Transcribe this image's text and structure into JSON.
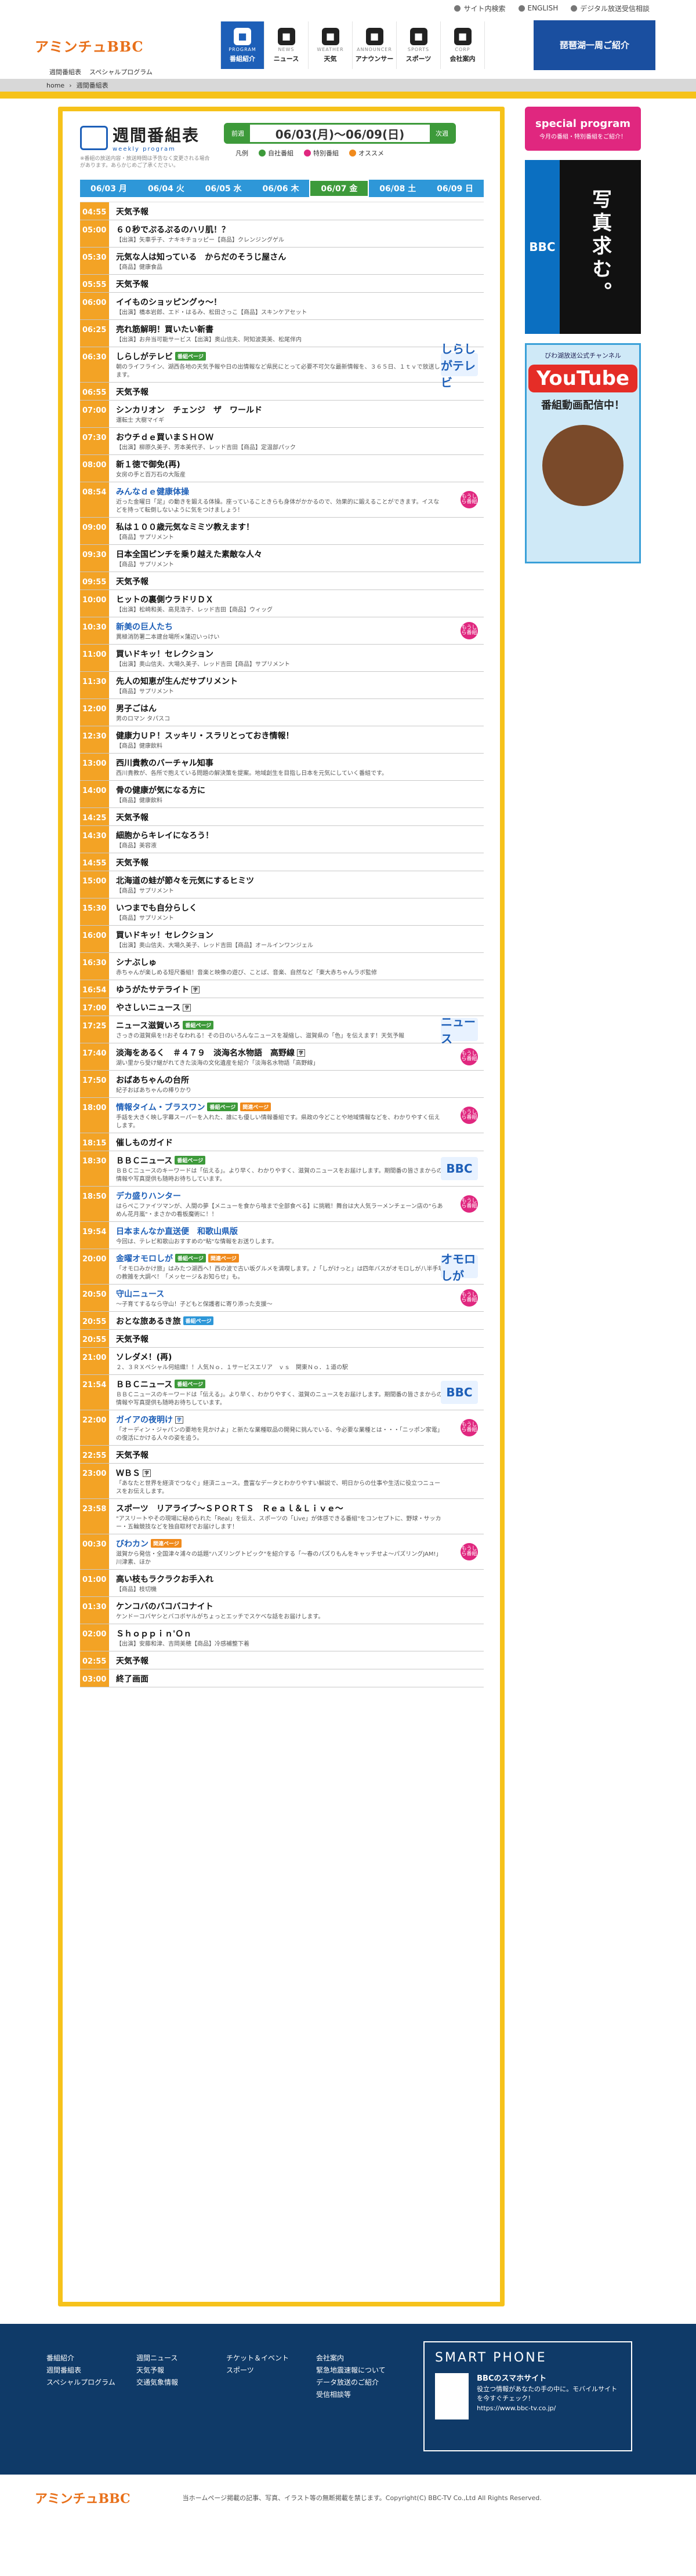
{
  "topbar": {
    "sitemap": "サイト内検索",
    "english": "ENGLISH",
    "digital": "デジタル放送受信相談"
  },
  "logo": {
    "text": "アミンチュBBC"
  },
  "sublinks": [
    "週間番組表",
    "スペシャルプログラム"
  ],
  "gnav": [
    {
      "en": "PROGRAM",
      "ja": "番組紹介",
      "icon": "tv-icon"
    },
    {
      "en": "NEWS",
      "ja": "ニュース",
      "icon": "news-icon"
    },
    {
      "en": "WEATHER",
      "ja": "天気",
      "icon": "weather-icon"
    },
    {
      "en": "ANNOUNCER",
      "ja": "アナウンサー",
      "icon": "mic-icon"
    },
    {
      "en": "SPORTS",
      "ja": "スポーツ",
      "icon": "sports-icon"
    },
    {
      "en": "CORP",
      "ja": "会社案内",
      "icon": "corp-icon"
    }
  ],
  "banner_top": "琵琶湖一周ご紹介",
  "breadcrumb": {
    "home": "home",
    "current": "週間番組表"
  },
  "weekly": {
    "title": "週間番組表",
    "title_en": "weekly program",
    "note": "※番組の放送内容・放送時間は予告なく変更される場合があります。あらかじめご了承ください。",
    "prev": "前週",
    "next": "次週",
    "range": "06/03(月)〜06/09(日)"
  },
  "legend": [
    {
      "label": "凡例"
    },
    {
      "label": "自社番組",
      "color": "#3d9a3a"
    },
    {
      "label": "特別番組",
      "color": "#e0277f"
    },
    {
      "label": "オススメ",
      "color": "#f08a1c"
    }
  ],
  "days": [
    "06/03 月",
    "06/04 火",
    "06/05 水",
    "06/06 木",
    "06/07 金",
    "06/08 土",
    "06/09 日"
  ],
  "programs": [
    {
      "time": "04:55",
      "title": "天気予報",
      "desc": ""
    },
    {
      "time": "05:00",
      "title": "６０秒でぷるぷるのハリ肌！？",
      "desc": "【出演】矢車乎子、ナキキチョッピー【商品】クレンジングゲル"
    },
    {
      "time": "05:30",
      "title": "元気な人は知っている　からだのそうじ屋さん",
      "desc": "【商品】健康食品"
    },
    {
      "time": "05:55",
      "title": "天気予報",
      "desc": ""
    },
    {
      "time": "06:00",
      "title": "イイものショッピングゥ〜！",
      "desc": "【出演】橋本岩郎、エド・はるみ、松田さっこ【商品】スキンケアセット"
    },
    {
      "time": "06:25",
      "title": "売れ筋解明！買いたい新書",
      "desc": "【出演】お弁当可能サービス【出演】奥山信夫、阿知波英美、松尾伴内"
    },
    {
      "time": "06:30",
      "title": "しらしがテレビ",
      "desc": "朝のライフライン、湖西各地の天気予報や日の出情報など県民にとって必要不可欠な最新情報を、３６５日、１ｔｖで放送します。",
      "tags": [
        "green",
        "番組ページ"
      ],
      "thumb": "しらしがテレビ"
    },
    {
      "time": "06:55",
      "title": "天気予報",
      "desc": ""
    },
    {
      "time": "07:00",
      "title": "シンカリオン　チェンジ　ザ　ワールド",
      "desc": "運転士 大樹マイギ"
    },
    {
      "time": "07:30",
      "title": "おウチｄｅ買いまＳＨＯＷ",
      "desc": "【出演】柳原久美子、芳本美代子、レッド吉田【商品】定温部パック"
    },
    {
      "time": "08:00",
      "title": "新１徳で御免(再)",
      "desc": "女房の手と百万石の大阪産"
    },
    {
      "time": "08:54",
      "title": "みんなｄｅ健康体操",
      "desc": "近った金曜日「足」の動きを鍛える体操。座っていることきらも身体がかかるので、効果的に鍛えることができます。イスなどを持って転倒しないように気をつけましょう！",
      "blue": true,
      "mark": "もうしら番組"
    },
    {
      "time": "09:00",
      "title": "私は１００歳元気なミミツ教えます！",
      "desc": "【商品】サプリメント"
    },
    {
      "time": "09:30",
      "title": "日本全国ピンチを乗り越えた素敵な人々",
      "desc": "【商品】サプリメント"
    },
    {
      "time": "09:55",
      "title": "天気予報",
      "desc": ""
    },
    {
      "time": "10:00",
      "title": "ヒットの裏側ウラドリＤＸ",
      "desc": "【出演】松崎和美、高見浩子、レッド吉田【商品】ウィッグ"
    },
    {
      "time": "10:30",
      "title": "新美の巨人たち",
      "desc": "異極消防署二本建台場所×蒲辺いっけい",
      "blue": true,
      "mark": "もうしら番組"
    },
    {
      "time": "11:00",
      "title": "買いドキッ！セレクション",
      "desc": "【出演】奥山信夫、大場久美子、レッド吉田【商品】サプリメント"
    },
    {
      "time": "11:30",
      "title": "先人の知恵が生んだサプリメント",
      "desc": "【商品】サプリメント"
    },
    {
      "time": "12:00",
      "title": "男子ごはん",
      "desc": "男のロマン タパスコ"
    },
    {
      "time": "12:30",
      "title": "健康力ＵＰ！スッキリ・スラリとっておき情報！",
      "desc": "【商品】健康飲料"
    },
    {
      "time": "13:00",
      "title": "西川貴教のバーチャル知事",
      "desc": "西川貴教が、各所で抱えている問題の解決策を提案。地域創生を目指し日本を元気にしていく番組です。"
    },
    {
      "time": "14:00",
      "title": "骨の健康が気になる方に",
      "desc": "【商品】健康飲料"
    },
    {
      "time": "14:25",
      "title": "天気予報",
      "desc": ""
    },
    {
      "time": "14:30",
      "title": "細胞からキレイになろう！",
      "desc": "【商品】美容液"
    },
    {
      "time": "14:55",
      "title": "天気予報",
      "desc": ""
    },
    {
      "time": "15:00",
      "title": "北海道の蛙が節々を元気にするヒミツ",
      "desc": "【商品】サプリメント"
    },
    {
      "time": "15:30",
      "title": "いつまでも自分らしく",
      "desc": "【商品】サプリメント"
    },
    {
      "time": "16:00",
      "title": "買いドキッ！セレクション",
      "desc": "【出演】奥山信夫、大場久美子、レッド吉田【商品】オールインワンジェル"
    },
    {
      "time": "16:30",
      "title": "シナぶしゅ",
      "desc": "赤ちゃんが楽しめる短尺番組！音楽と映像の遊び、ことば、音楽、自然など「東大赤ちゃんラボ監修"
    },
    {
      "time": "16:54",
      "title": "ゆうがたサテライト",
      "desc": "",
      "cc": "字"
    },
    {
      "time": "17:00",
      "title": "やさしいニュース",
      "desc": "",
      "cc": "字"
    },
    {
      "time": "17:25",
      "title": "ニュース滋賀いろ",
      "desc": "さっきの滋賀県を!!おそなわれる！その日のいろんなニュースを凝縮し、滋賀県の「色」を伝えます！天気予報",
      "tags": [
        "green",
        "番組ページ"
      ],
      "thumb": "ニュース"
    },
    {
      "time": "17:40",
      "title": "淡海をあるく　＃４７９　淡海名水物語　高野線",
      "desc": "湖い里から受け継がれてきた淡海の文化遺産を紹介「淡海名水物語「高野線」",
      "cc": "字",
      "mark": "もうしら番組"
    },
    {
      "time": "17:50",
      "title": "おばあちゃんの台所",
      "desc": "紀子おばあちゃんの棒りかり"
    },
    {
      "time": "18:00",
      "title": "情報タイム・ブラスワン",
      "desc": "手話を大きく映し字幕スーパーを入れた、誰にも優しい情報番組です。県政の今どことや地域情報などを、わかりやすく伝えします。",
      "blue": true,
      "tags": [
        "green",
        "番組ページ",
        "orange",
        "関連ページ"
      ],
      "mark": "もうしら番組"
    },
    {
      "time": "18:15",
      "title": "催しものガイド",
      "desc": ""
    },
    {
      "time": "18:30",
      "title": "ＢＢＣニュース",
      "desc": "ＢＢＣニュースのキーワードは「伝える」。より早く、わかりやすく、滋賀のニュースをお届けします。期間番の皆さまからの情報や写真提供も随時お待ちしています。",
      "tags": [
        "green",
        "番組ページ"
      ],
      "thumb": "BBC"
    },
    {
      "time": "18:50",
      "title": "デカ盛りハンター",
      "desc": "はらぺこファイツマンが、人間の夢【メニューを食から喰まで全部食べる】に挑戦！舞台は大人気ラーメンチェーン店の\"らあめん花月嵐\"・まさかの看板魔術に！！",
      "blue": true,
      "mark": "もうしら番組"
    },
    {
      "time": "19:54",
      "title": "日本まんなか直送便　和歌山県版",
      "desc": "今回は、テレビ和歌山おすすめの\"粘\"な情報をお送りします。",
      "blue": true
    },
    {
      "time": "20:00",
      "title": "金曜オモロしが",
      "desc": "「オモロみかけ旅」はみたつ湖西へ！西の波で古い坂グルメを満喫します。♪「しがけっと」は四年バスがオモロしが八半手場の教雑を大調べ！「メッセージ＆お知らせ」も。",
      "blue": true,
      "tags": [
        "green",
        "番組ページ",
        "orange",
        "関連ページ"
      ],
      "thumb": "オモロしが"
    },
    {
      "time": "20:50",
      "title": "守山ニュース",
      "desc": "〜子育てするなら守山！子どもと保護者に寄り添った支援〜",
      "blue": true,
      "mark": "もうしら番組"
    },
    {
      "time": "20:55",
      "title": "おとな旅あるき旅",
      "desc": "",
      "tags": [
        "blue",
        "番組ページ"
      ]
    },
    {
      "time": "20:55",
      "title": "天気予報",
      "desc": ""
    },
    {
      "time": "21:00",
      "title": "ソレダメ！(再)",
      "desc": "２、３ＲＸペシャル何組織！！人気Ｎｏ．１サービスエリア　ｖｓ　関東Ｎｏ．１道の駅"
    },
    {
      "time": "21:54",
      "title": "ＢＢＣニュース",
      "desc": "ＢＢＣニュースのキーワードは「伝える」。より早く、わかりやすく、滋賀のニュースをお届けします。期間番の皆さまからの情報や写真提供も随時お待ちしています。",
      "tags": [
        "green",
        "番組ページ"
      ],
      "thumb": "BBC"
    },
    {
      "time": "22:00",
      "title": "ガイアの夜明け",
      "desc": "「オーディン・ジャパンの要地を見かけよ」と新たな業種取品の開発に挑んでいる、今必要な業種とは・・・「ニッポン家電」の復活にかける人々の姿を追う。",
      "blue": true,
      "cc": "字",
      "mark": "もうしら番組"
    },
    {
      "time": "22:55",
      "title": "天気予報",
      "desc": ""
    },
    {
      "time": "23:00",
      "title": "ＷＢＳ",
      "desc": "「あなたと世界を経済でつなぐ」経済ニュース。豊富なデータとわかりやすい解説で、明日からの仕事や生活に役立つニュースをお伝えします。",
      "cc": "字"
    },
    {
      "time": "23:58",
      "title": "スポーツ　リアライブ〜ＳＰＯＲＴＳ　Ｒｅａｌ＆Ｌｉｖｅ〜",
      "desc": "\"アスリートやその現場に秘められた「Real」を伝え、スポーツの「Live」が体感できる番組\"をコンセプトに、野球・サッカー・五輪競技などを独自取材でお届けします！"
    },
    {
      "time": "00:30",
      "title": "びわカン",
      "desc": "滋賀から発信・全国津々浦々の話題\"ハズリングトピック\"を紹介する「〜春のパズりもんをキャッチせよ〜パズリングJAM!」川津素、ほか",
      "blue": true,
      "tags": [
        "orange",
        "関連ページ"
      ],
      "mark": "もうしら番組"
    },
    {
      "time": "01:00",
      "title": "高い枝もラクラクお手入れ",
      "desc": "【商品】枝切機"
    },
    {
      "time": "01:30",
      "title": "ケンコバのバコバコナイト",
      "desc": "ケンドーコバヤシとバコボヤルがちょっとエッチでスケベな話をお届けします。"
    },
    {
      "time": "02:00",
      "title": "Ｓｈｏｐｐｉｎ'Ｏｎ",
      "desc": "【出演】安藤和津、吉岡美穂【商品】冷感補整下着"
    },
    {
      "time": "02:55",
      "title": "天気予報",
      "desc": ""
    },
    {
      "time": "03:00",
      "title": "終了画面",
      "desc": ""
    }
  ],
  "side": {
    "special": "special program",
    "special_sub": "今月の番組・特別番組をご紹介！",
    "photo_label": "BBC",
    "photo_text": "写真求む。",
    "yt_top": "びわ湖放送公式チャンネル",
    "yt_logo": "YouTube",
    "yt_sub": "番組動画配信中！"
  },
  "footer": {
    "col1": [
      "番組紹介",
      "週間番組表",
      "スペシャルプログラム"
    ],
    "col2": [
      "週間ニュース",
      "天気予報",
      "交通気象情報"
    ],
    "col3": [
      "チケット＆イベント",
      "スポーツ"
    ],
    "col4": [
      "会社案内",
      "緊急地震速報について",
      "データ放送のご紹介",
      "受信相談等"
    ],
    "smart_title": "SMART PHONE",
    "smart_name": "BBCのスマホサイト",
    "smart_desc": "役立つ情報があなたの手の中に。モバイルサイトを今すぐチェック！",
    "smart_url": "https://www.bbc-tv.co.jp/"
  },
  "copyright": "当ホームページ掲載の記事、写真、イラスト等の無断掲載を禁じます。Copyright(C) BBC-TV Co.,Ltd All Rights Reserved."
}
